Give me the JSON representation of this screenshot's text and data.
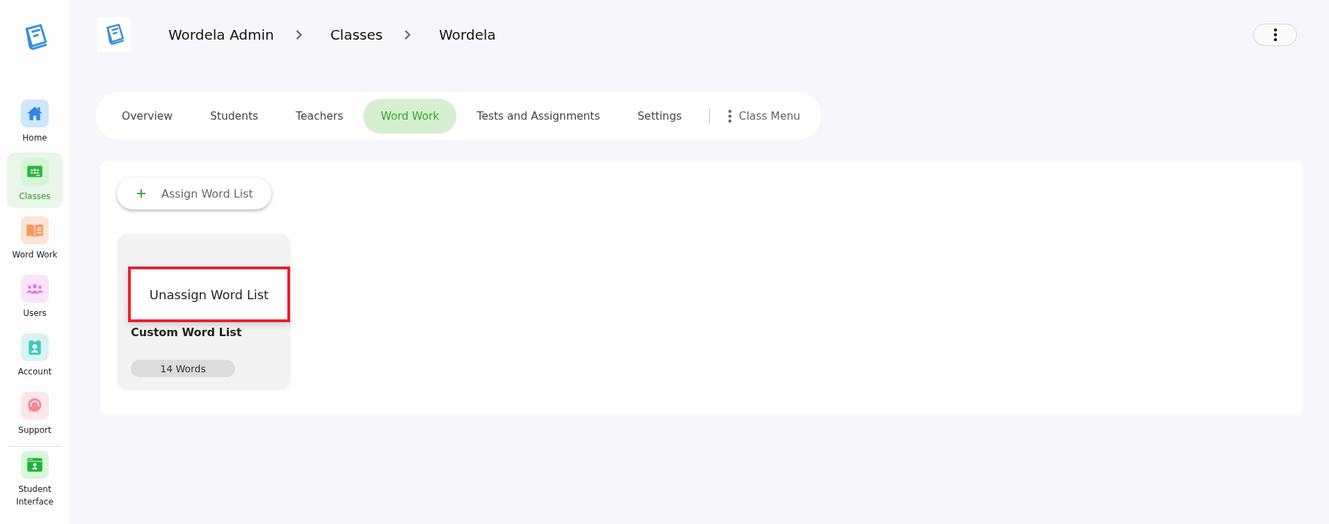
{
  "sidebar": {
    "items": [
      {
        "label": "Home",
        "kind": "home",
        "selected": false
      },
      {
        "label": "Classes",
        "kind": "classes",
        "selected": true
      },
      {
        "label": "Word Work",
        "kind": "book",
        "selected": false
      },
      {
        "label": "Users",
        "kind": "users",
        "selected": false
      },
      {
        "label": "Account",
        "kind": "account",
        "selected": false
      },
      {
        "label": "Support",
        "kind": "support",
        "selected": false
      },
      {
        "label": "Student Interface",
        "kind": "student",
        "selected": false
      }
    ]
  },
  "breadcrumbs": [
    "Wordela Admin",
    "Classes",
    "Wordela"
  ],
  "tabs": [
    {
      "label": "Overview",
      "selected": false
    },
    {
      "label": "Students",
      "selected": false
    },
    {
      "label": "Teachers",
      "selected": false
    },
    {
      "label": "Word Work",
      "selected": true
    },
    {
      "label": "Tests and Assignments",
      "selected": false
    },
    {
      "label": "Settings",
      "selected": false
    }
  ],
  "class_menu": {
    "label": "Class Menu"
  },
  "assign_button": {
    "label": "Assign Word List"
  },
  "word_lists": [
    {
      "title": "Custom Word List",
      "count": "14 Words",
      "menu": {
        "items": [
          "Unassign Word List"
        ],
        "highlighted": true
      }
    }
  ]
}
